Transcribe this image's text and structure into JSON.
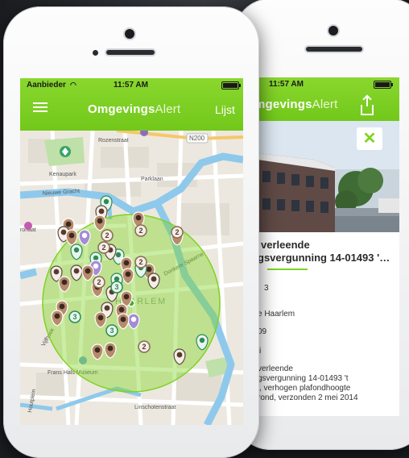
{
  "front": {
    "status": {
      "carrier": "Aanbieder",
      "time": "11:57 AM"
    },
    "header": {
      "title_bold": "Omgevings",
      "title_light": "Alert",
      "list_button": "Lijst"
    },
    "map": {
      "labels": {
        "road_n200": "N200",
        "kenaupark": "Kenaupark",
        "rozenstraat": "Rozenstraat",
        "parklaan": "Parklaan",
        "nieuwe_gracht": "Nieuwe Gracht",
        "ronaat": "ronaat",
        "donkere_spaarne": "Donkere Spaarne",
        "haarlem": "HAARLEM",
        "frans_hals": "Frans Hals Museum",
        "houtplein": "Houtplein",
        "linschotenstraat": "Linschotenstraat",
        "vijfhoek": "Vijfhoek"
      },
      "cluster_counts": [
        "2",
        "2",
        "2",
        "2",
        "2",
        "3",
        "3",
        "2",
        "3",
        "2"
      ]
    }
  },
  "back": {
    "status": {
      "time": "11:57 AM"
    },
    "header": {
      "title_bold": "mgevings",
      "title_light": "Alert"
    },
    "detail": {
      "title_line1": "verleende",
      "title_line2": "gsvergunning 14-01493 '…",
      "lines": [
        "3",
        "e Haarlem",
        "09",
        "i",
        "verleende",
        "gsvergunning 14-01493 't",
        "', verhogen plafondhoogte",
        "rond, verzonden 2 mei 2014"
      ]
    }
  },
  "colors": {
    "accent": "#7ed321",
    "circle": "rgba(126,211,33,0.45)",
    "pin_brown": "#b88a6c",
    "pin_dark": "#3b3b3b",
    "pin_green": "#2d8a55",
    "pin_purple": "#8b6cc4"
  }
}
